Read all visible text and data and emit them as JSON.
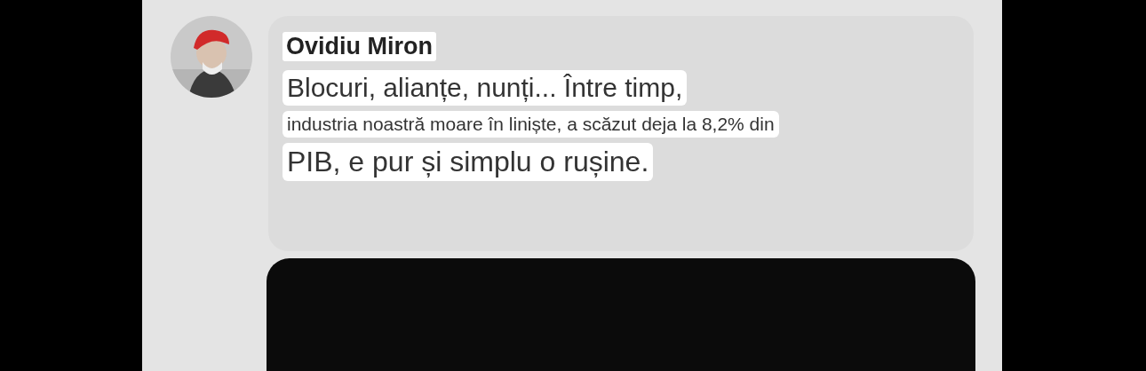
{
  "comment": {
    "author": "Ovidiu Miron",
    "lines": [
      "Blocuri, alianțe, nunți... Între timp,",
      "industria noastră moare în liniște, a scăzut deja la 8,2% din",
      "PIB, e pur și simplu o rușine."
    ]
  }
}
